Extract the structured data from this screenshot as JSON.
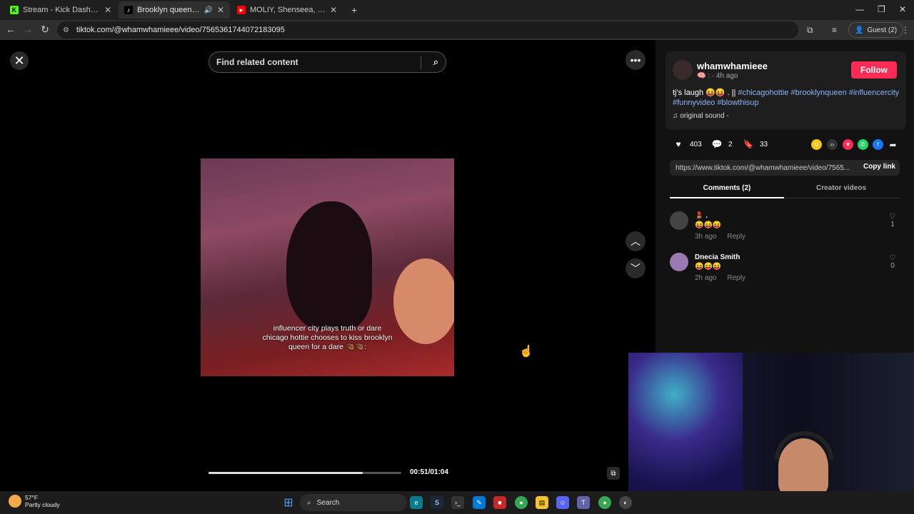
{
  "browser": {
    "tabs": [
      {
        "title": "Stream - Kick Dashboard",
        "favicon": "K",
        "color": "#53fc18"
      },
      {
        "title": "Brooklyn queen (@brookly",
        "favicon": "♪",
        "color": "#000000"
      },
      {
        "title": "MOLIY, Shenseea, Skillibeng, Sh",
        "favicon": "▶",
        "color": "#ff0000"
      }
    ],
    "url": "tiktok.com/@whamwhamieee/video/7565361744072183095",
    "guest_label": "Guest (2)"
  },
  "search": {
    "placeholder": "Find related content"
  },
  "video": {
    "caption_lines": [
      "influencer city plays truth or dare",
      "chicago hottie chooses to kiss brooklyn",
      "queen for a dare 🤏🏾🤏🏾:"
    ],
    "time": "00:51/01:04",
    "progress": 0.8
  },
  "post": {
    "username": "whamwhamieee",
    "subline": "🧠 : · 4h ago",
    "follow_label": "Follow",
    "desc_text": "tj's laugh 😝😝 . ||",
    "hashtags": [
      "#chicagohottie",
      "#brooklynqueen",
      "#influencercity",
      "#funnyvideo",
      "#blowthisup"
    ],
    "sound": "original sound - ",
    "likes": "403",
    "comments": "2",
    "saves": "33",
    "link": "https://www.tiktok.com/@whamwhamieee/video/7565...",
    "copy_label": "Copy link"
  },
  "tabs": {
    "comments": "Comments (2)",
    "creator": "Creator videos"
  },
  "comments": [
    {
      "name": "💄 .",
      "text": "😝😝😝",
      "time": "3h ago",
      "reply": "Reply",
      "likes": "1"
    },
    {
      "name": "Dnecia Smith",
      "text": "😝😝😝",
      "time": "2h ago",
      "reply": "Reply",
      "likes": "0"
    }
  ],
  "taskbar": {
    "temp": "57°F",
    "weather": "Partly cloudy",
    "search": "Search"
  }
}
